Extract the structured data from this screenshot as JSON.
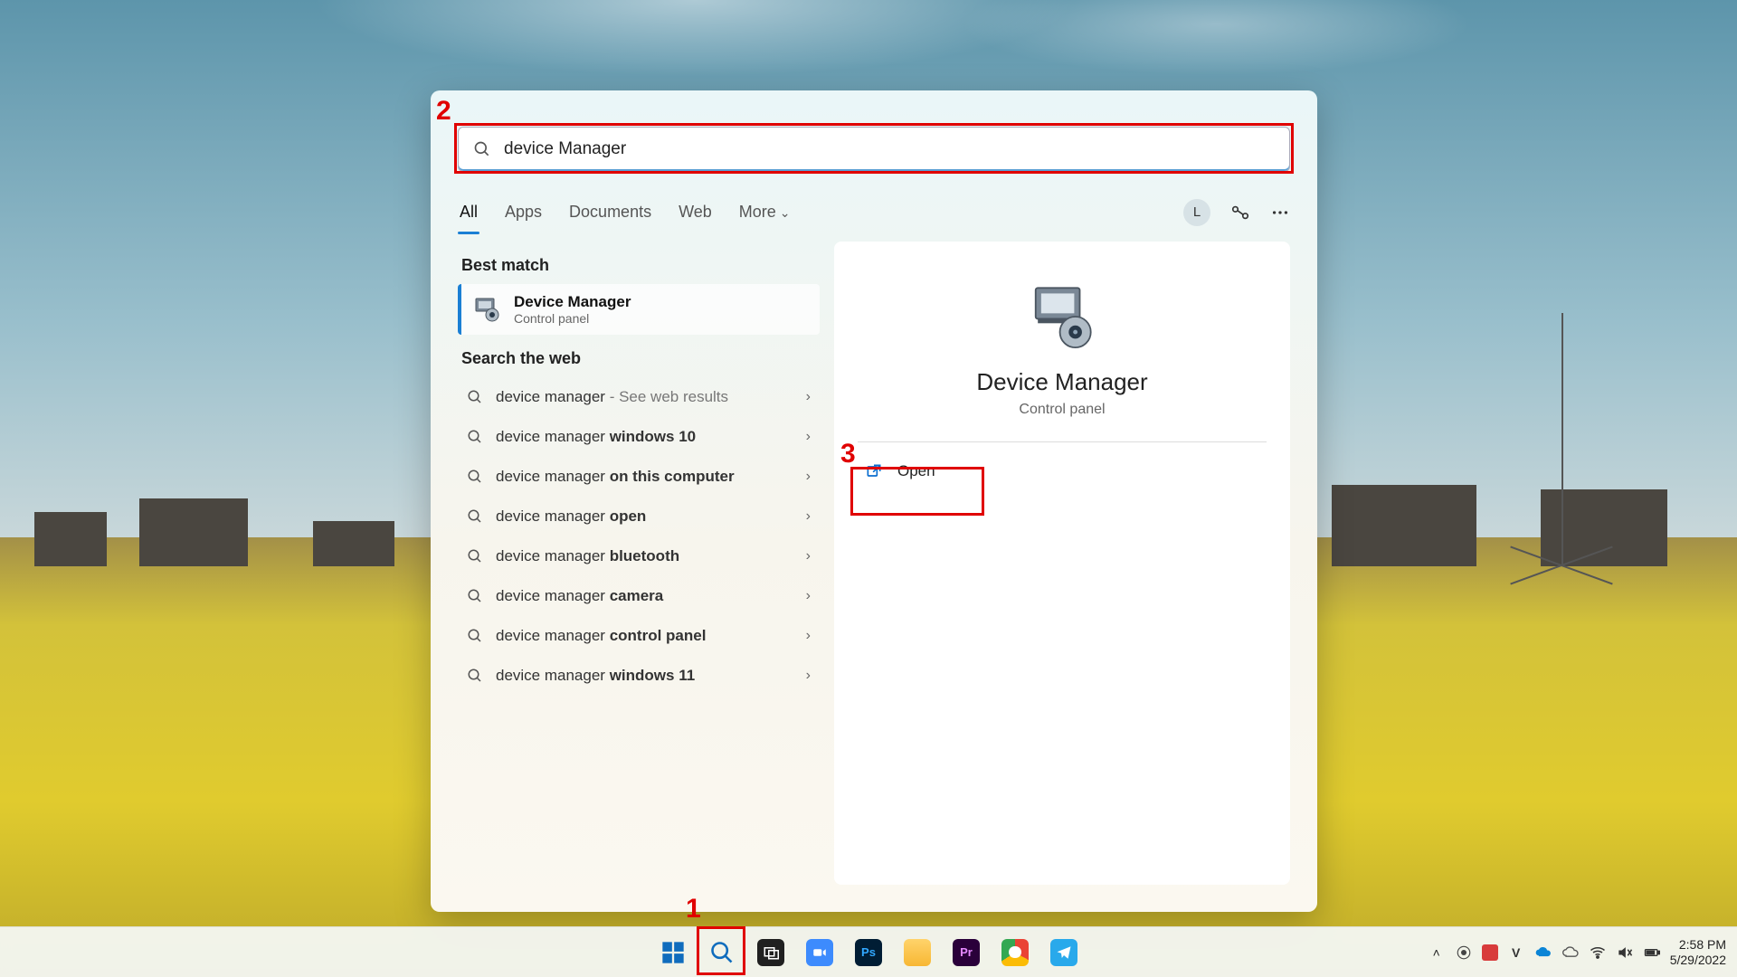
{
  "search": {
    "query": "device Manager"
  },
  "tabs": {
    "all": "All",
    "apps": "Apps",
    "documents": "Documents",
    "web": "Web",
    "more": "More"
  },
  "user": {
    "initial": "L"
  },
  "sections": {
    "best_match": "Best match",
    "search_web": "Search the web"
  },
  "best_match": {
    "title": "Device Manager",
    "subtitle": "Control panel"
  },
  "web_suggestions": [
    {
      "prefix": "device manager",
      "bold": "",
      "suffix": " - See web results"
    },
    {
      "prefix": "device manager ",
      "bold": "windows 10",
      "suffix": ""
    },
    {
      "prefix": "device manager ",
      "bold": "on this computer",
      "suffix": ""
    },
    {
      "prefix": "device manager ",
      "bold": "open",
      "suffix": ""
    },
    {
      "prefix": "device manager ",
      "bold": "bluetooth",
      "suffix": ""
    },
    {
      "prefix": "device manager ",
      "bold": "camera",
      "suffix": ""
    },
    {
      "prefix": "device manager ",
      "bold": "control panel",
      "suffix": ""
    },
    {
      "prefix": "device manager ",
      "bold": "windows 11",
      "suffix": ""
    }
  ],
  "detail": {
    "title": "Device Manager",
    "subtitle": "Control panel",
    "open": "Open"
  },
  "annotations": {
    "a1": "1",
    "a2": "2",
    "a3": "3"
  },
  "clock": {
    "time": "2:58 PM",
    "date": "5/29/2022"
  }
}
